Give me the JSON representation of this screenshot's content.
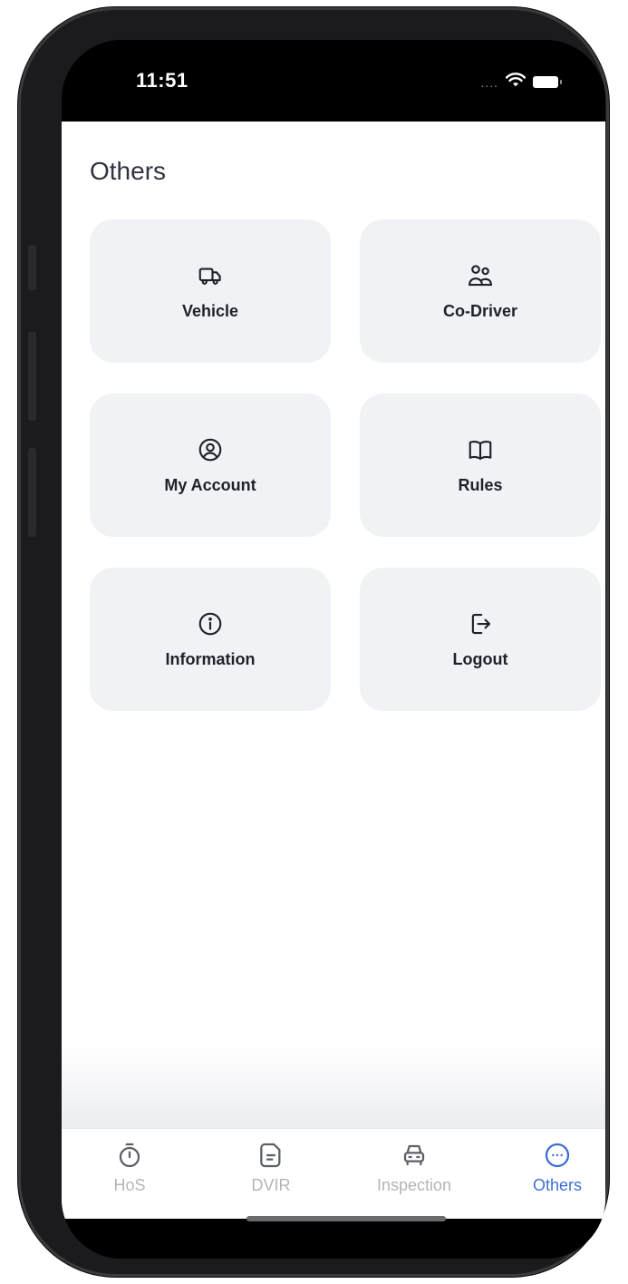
{
  "status_bar": {
    "time": "11:51",
    "signal_text": "....",
    "icons": [
      "wifi-icon",
      "battery-icon"
    ]
  },
  "page": {
    "title": "Others"
  },
  "tiles": [
    {
      "label": "Vehicle",
      "icon": "truck-icon"
    },
    {
      "label": "Co-Driver",
      "icon": "users-icon"
    },
    {
      "label": "My Account",
      "icon": "user-circle-icon"
    },
    {
      "label": "Rules",
      "icon": "book-icon"
    },
    {
      "label": "Information",
      "icon": "info-icon"
    },
    {
      "label": "Logout",
      "icon": "logout-icon"
    }
  ],
  "tab_bar": {
    "active": "Others",
    "tabs": [
      {
        "label": "HoS",
        "icon": "stopwatch-icon"
      },
      {
        "label": "DVIR",
        "icon": "document-icon"
      },
      {
        "label": "Inspection",
        "icon": "car-icon"
      },
      {
        "label": "Others",
        "icon": "more-circle-icon"
      }
    ]
  },
  "colors": {
    "accent": "#3d6fd6",
    "tile_bg": "#f1f2f5",
    "text": "#1e2129",
    "inactive": "#b3b5ba"
  }
}
